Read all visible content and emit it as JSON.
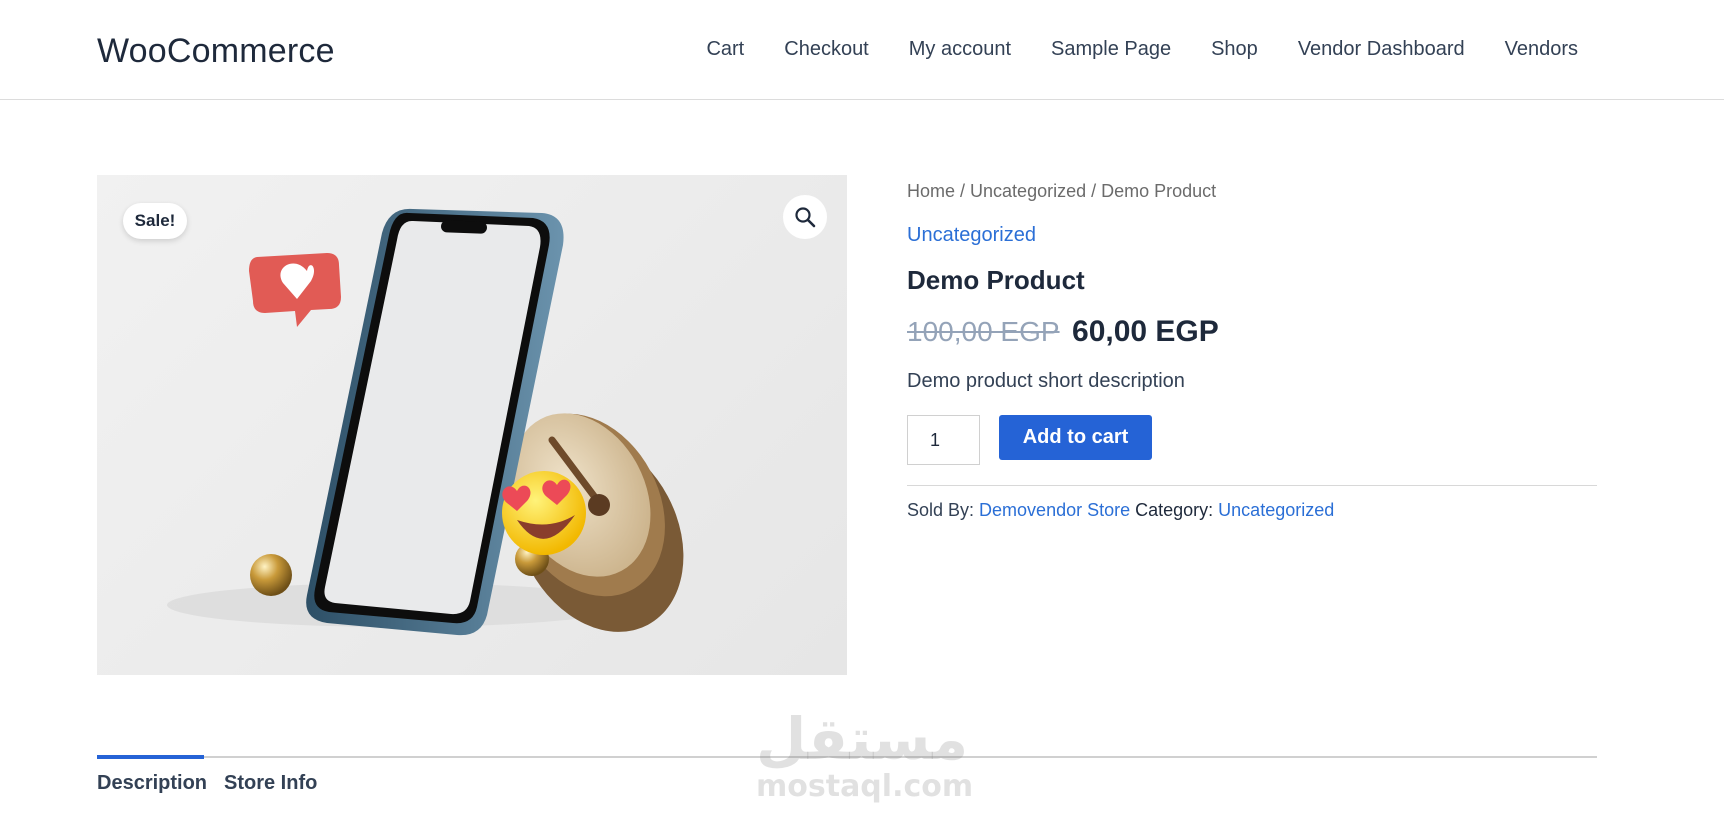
{
  "header": {
    "site_title": "WooCommerce",
    "nav": [
      "Cart",
      "Checkout",
      "My account",
      "Sample Page",
      "Shop",
      "Vendor Dashboard",
      "Vendors"
    ]
  },
  "gallery": {
    "sale_badge": "Sale!",
    "zoom_icon": "magnifier-icon",
    "image_subject": "phone-drum-emoji-product-image"
  },
  "breadcrumb": {
    "home": "Home",
    "sep1": " / ",
    "category": "Uncategorized",
    "sep2": " / ",
    "current": "Demo Product"
  },
  "product": {
    "category": "Uncategorized",
    "title": "Demo Product",
    "old_price": "100,00 EGP",
    "new_price": "60,00 EGP",
    "short_description": "Demo product short description",
    "quantity": "1",
    "add_to_cart": "Add to cart"
  },
  "meta": {
    "sold_by_label": "Sold By: ",
    "vendor": "Demovendor Store",
    "category_label": " Category: ",
    "category": "Uncategorized"
  },
  "tabs": [
    "Description",
    "Store Info"
  ],
  "watermark": {
    "arabic": "مستقل",
    "latin": "mostaql.com"
  },
  "colors": {
    "accent": "#2563d6",
    "link": "#2b6fd6",
    "text": "#1e293b"
  }
}
